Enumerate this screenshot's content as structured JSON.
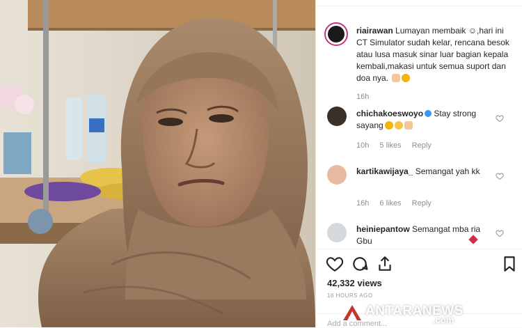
{
  "post": {
    "username": "riairawan",
    "caption": " Lumayan membaik ☺,hari ini CT Simulator sudah kelar, rencana besok atau lusa masuk sinar luar bagian kepala kembali,makasi untuk semua suport dan doa nya. ",
    "time": "16h"
  },
  "comments": [
    {
      "username": "chichakoeswoyo",
      "text": " Stay strong sayang",
      "time": "10h",
      "likes": "5 likes",
      "reply": "Reply",
      "verified": true
    },
    {
      "username": "kartikawijaya_",
      "text": " Semangat yah kk",
      "time": "16h",
      "likes": "6 likes",
      "reply": "Reply"
    },
    {
      "username": "heiniepantow",
      "text": " Semangat mba ria Gbu",
      "time": "",
      "likes": "",
      "reply": ""
    }
  ],
  "actions": {
    "icons": [
      "heart-icon",
      "comment-icon",
      "share-icon",
      "bookmark-icon"
    ]
  },
  "stats": {
    "views": "42,332 views",
    "ago": "16 HOURS AGO"
  },
  "add_comment": "Add a comment...",
  "watermark": {
    "brand": "ANTARANEWS",
    "suffix": ".com"
  },
  "colors": {
    "accent": "#3897f0",
    "story_ring": "#c13584",
    "watermark": "#ffffff"
  }
}
